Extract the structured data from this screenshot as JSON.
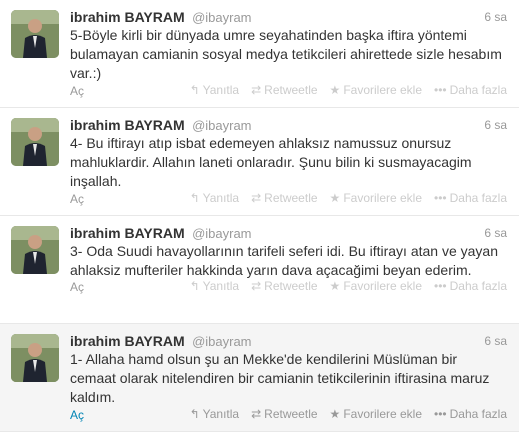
{
  "tweets": [
    {
      "name": "ibrahim BAYRAM",
      "handle": "@ibayram",
      "time": "6 sa",
      "lines": [
        "5-Böyle kirli bir dünyada umre seyahatinden başka iftira yöntemi",
        "bulamayan camianin sosyal medya tetikcileri ahirettede sizle hesabım",
        "var.:)"
      ],
      "expand": "Aç",
      "actions": {
        "reply": "Yanıtla",
        "retweet": "Retweetle",
        "favorite": "Favorilere ekle",
        "more": "Daha fazla"
      }
    },
    {
      "name": "ibrahim BAYRAM",
      "handle": "@ibayram",
      "time": "6 sa",
      "lines": [
        "4- Bu iftirayı atıp isbat edemeyen ahlaksız namussuz onursuz",
        "mahluklardir. Allahın laneti onlaradır. Şunu bilin ki susmayacagim",
        "inşallah."
      ],
      "expand": "Aç",
      "actions": {
        "reply": "Yanıtla",
        "retweet": "Retweetle",
        "favorite": "Favorilere ekle",
        "more": "Daha fazla"
      }
    },
    {
      "name": "ibrahim BAYRAM",
      "handle": "@ibayram",
      "time": "6 sa",
      "lines": [
        "3- Oda Suudi havayollarının tarifeli seferi idi. Bu iftirayı atan ve yayan",
        "ahlaksiz mufteriler hakkinda yarın dava açacağimi beyan ederim.",
        ""
      ],
      "expand": "Aç",
      "actions": {
        "reply": "Yanıtla",
        "retweet": "Retweetle",
        "favorite": "Favorilere ekle",
        "more": "Daha fazla"
      }
    },
    {
      "name": "ibrahim BAYRAM",
      "handle": "@ibayram",
      "time": "6 sa",
      "lines": [
        "1- Allaha hamd olsun şu an Mekke'de kendilerini Müslüman bir",
        "cemaat olarak nitelendiren bir camianin tetikcilerinin iftirasina maruz",
        "kaldım."
      ],
      "expand": "Aç",
      "actions": {
        "reply": "Yanıtla",
        "retweet": "Retweetle",
        "favorite": "Favorilere ekle",
        "more": "Daha fazla"
      }
    }
  ],
  "icons": {
    "reply": "reply-arrow",
    "retweet": "retweet-arrows",
    "favorite": "star",
    "more": "dots"
  },
  "colors": {
    "link": "#0084b4",
    "muted": "#999999",
    "text": "#333333"
  }
}
